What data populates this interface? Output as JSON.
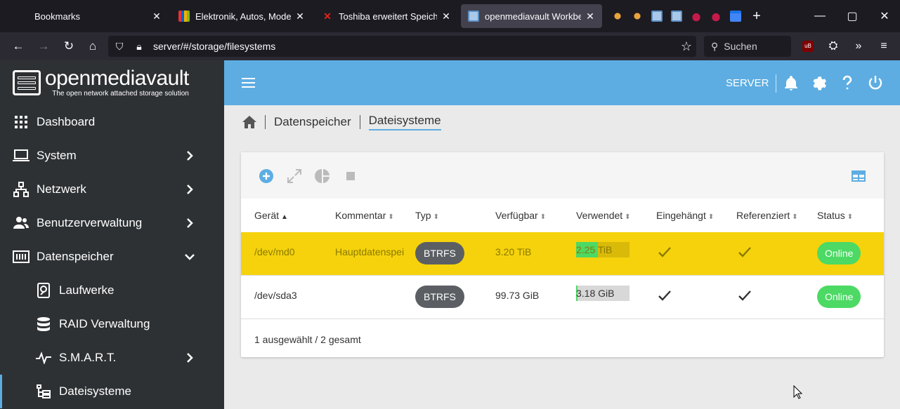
{
  "browser": {
    "tabs": [
      {
        "label": "Bookmarks",
        "active": false
      },
      {
        "label": "Elektronik, Autos, Mode, Sam",
        "active": false
      },
      {
        "label": "Toshiba erweitert Speicher de",
        "active": false
      },
      {
        "label": "openmediavault Workbench",
        "active": true
      }
    ],
    "url": "server/#/storage/filesystems",
    "search_placeholder": "Suchen"
  },
  "app": {
    "logo_title": "openmediavault",
    "logo_subtitle": "The open network attached storage solution",
    "server_label": "SERVER",
    "accent": "#5dade2"
  },
  "sidebar": {
    "items": [
      {
        "label": "Dashboard",
        "icon": "dashboard-grid-icon"
      },
      {
        "label": "System",
        "icon": "laptop-icon"
      },
      {
        "label": "Netzwerk",
        "icon": "network-icon"
      },
      {
        "label": "Benutzerverwaltung",
        "icon": "users-icon"
      },
      {
        "label": "Datenspeicher",
        "icon": "storage-icon"
      },
      {
        "label": "Laufwerke",
        "icon": "disk-icon"
      },
      {
        "label": "RAID Verwaltung",
        "icon": "database-icon"
      },
      {
        "label": "S.M.A.R.T.",
        "icon": "pulse-icon"
      },
      {
        "label": "Dateisysteme",
        "icon": "file-tree-icon"
      }
    ]
  },
  "breadcrumb": {
    "items": [
      "Datenspeicher",
      "Dateisysteme"
    ]
  },
  "table": {
    "columns": [
      "Gerät",
      "Kommentar",
      "Typ",
      "Verfügbar",
      "Verwendet",
      "Eingehängt",
      "Referenziert",
      "Status"
    ],
    "rows": [
      {
        "device": "/dev/md0",
        "comment": "Hauptdatenspeicher",
        "type": "BTRFS",
        "available": "3.20 TiB",
        "used": "2.25 TiB",
        "used_fraction": 0.41,
        "mounted": true,
        "referenced": true,
        "status": "Online",
        "selected": true
      },
      {
        "device": "/dev/sda3",
        "comment": "",
        "type": "BTRFS",
        "available": "99.73 GiB",
        "used": "3.18 GiB",
        "used_fraction": 0.03,
        "mounted": true,
        "referenced": true,
        "status": "Online",
        "selected": false
      }
    ],
    "footer": "1 ausgewählt / 2 gesamt"
  }
}
